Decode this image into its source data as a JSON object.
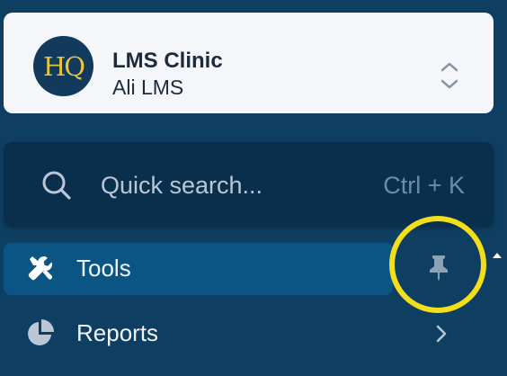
{
  "org": {
    "logo_text": "HQ",
    "name": "LMS Clinic",
    "user": "Ali LMS",
    "switch_icon": "chevron-up-down-icon"
  },
  "search": {
    "placeholder": "Quick search...",
    "shortcut": "Ctrl + K",
    "icon": "search-icon"
  },
  "nav": {
    "items": [
      {
        "label": "Tools",
        "icon": "tools-icon",
        "active": true,
        "pin_icon": "pin-icon"
      },
      {
        "label": "Reports",
        "icon": "pie-chart-icon",
        "active": false,
        "trailing_icon": "chevron-right-icon"
      }
    ]
  },
  "colors": {
    "sidebar_bg": "#0e3e62",
    "card_bg": "#f4f6f9",
    "search_bg": "#0a2f4d",
    "active_item_bg": "#0b5584",
    "highlight": "#f2df1a",
    "logo_text": "#e8c33e"
  }
}
